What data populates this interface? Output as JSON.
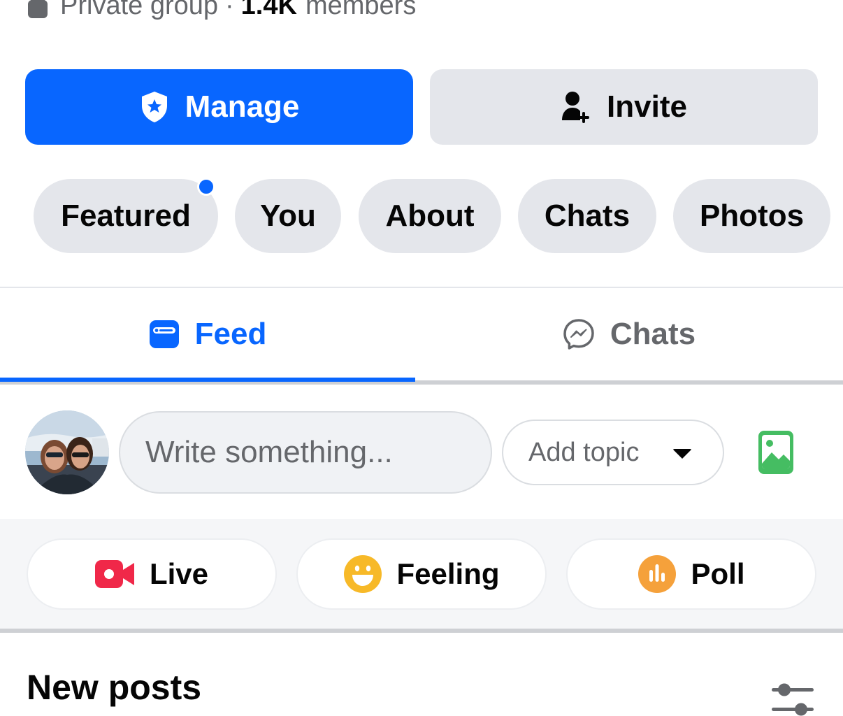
{
  "group": {
    "privacy": "Private group",
    "separator": "·",
    "member_count": "1.4K",
    "member_label": "members"
  },
  "buttons": {
    "manage": "Manage",
    "invite": "Invite"
  },
  "chips": [
    {
      "label": "Featured",
      "has_dot": true
    },
    {
      "label": "You"
    },
    {
      "label": "About"
    },
    {
      "label": "Chats"
    },
    {
      "label": "Photos"
    }
  ],
  "tabs": {
    "feed": "Feed",
    "chats": "Chats",
    "active": "Feed"
  },
  "composer": {
    "placeholder": "Write something...",
    "topic_label": "Add topic"
  },
  "actions": {
    "live": "Live",
    "feeling": "Feeling",
    "poll": "Poll"
  },
  "section": {
    "title": "New posts"
  },
  "colors": {
    "accent": "#0866ff",
    "live": "#f02849",
    "feeling": "#f7b928",
    "poll": "#f5a13b",
    "photo": "#45bd62"
  },
  "icons": {
    "manage": "shield-star-icon",
    "invite": "person-add-icon",
    "feed": "feed-icon",
    "chats": "messenger-icon",
    "photo": "photo-icon",
    "live": "video-camera-icon",
    "feeling": "smiley-icon",
    "poll": "poll-icon",
    "filter": "sliders-icon"
  }
}
